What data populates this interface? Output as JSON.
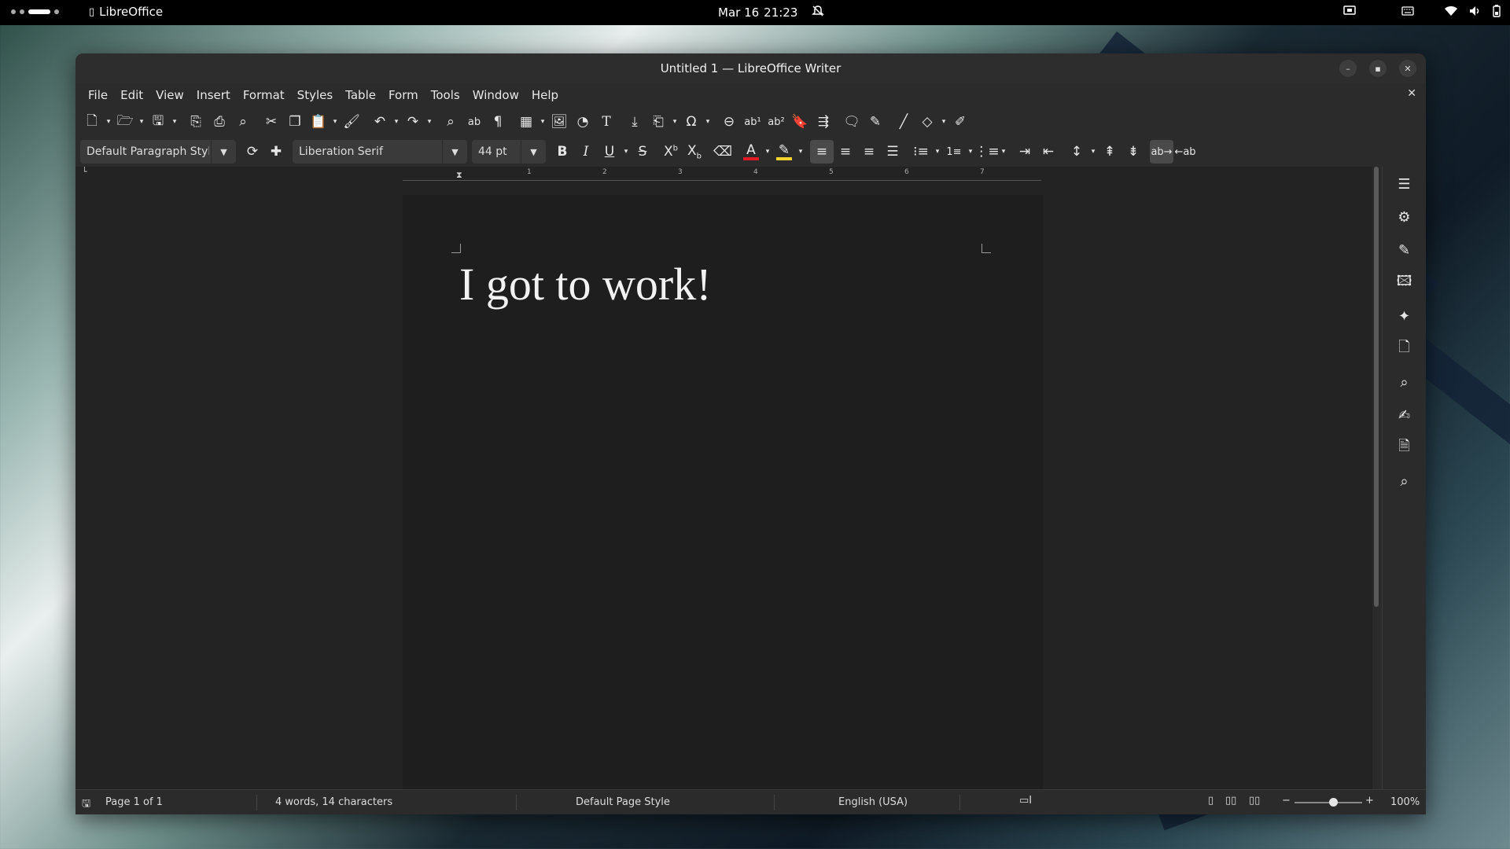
{
  "topbar": {
    "app_name": "LibreOffice",
    "date": "Mar 16",
    "time": "21:23"
  },
  "window": {
    "title": "Untitled 1 — LibreOffice Writer"
  },
  "menu": [
    "File",
    "Edit",
    "View",
    "Insert",
    "Format",
    "Styles",
    "Table",
    "Form",
    "Tools",
    "Window",
    "Help"
  ],
  "formatting": {
    "paragraph_style": "Default Paragraph Style",
    "font_name": "Liberation Serif",
    "font_size": "44 pt"
  },
  "ruler": {
    "labels": [
      "1",
      "2",
      "3",
      "4",
      "5",
      "6",
      "7"
    ]
  },
  "document": {
    "text": "I got to work!"
  },
  "status": {
    "page": "Page 1 of 1",
    "word_count": "4 words, 14 characters",
    "page_style": "Default Page Style",
    "language": "English (USA)",
    "zoom": "100%"
  },
  "colors": {
    "font_color_bar": "#e01b24",
    "highlight_bar": "#f6d32d"
  }
}
